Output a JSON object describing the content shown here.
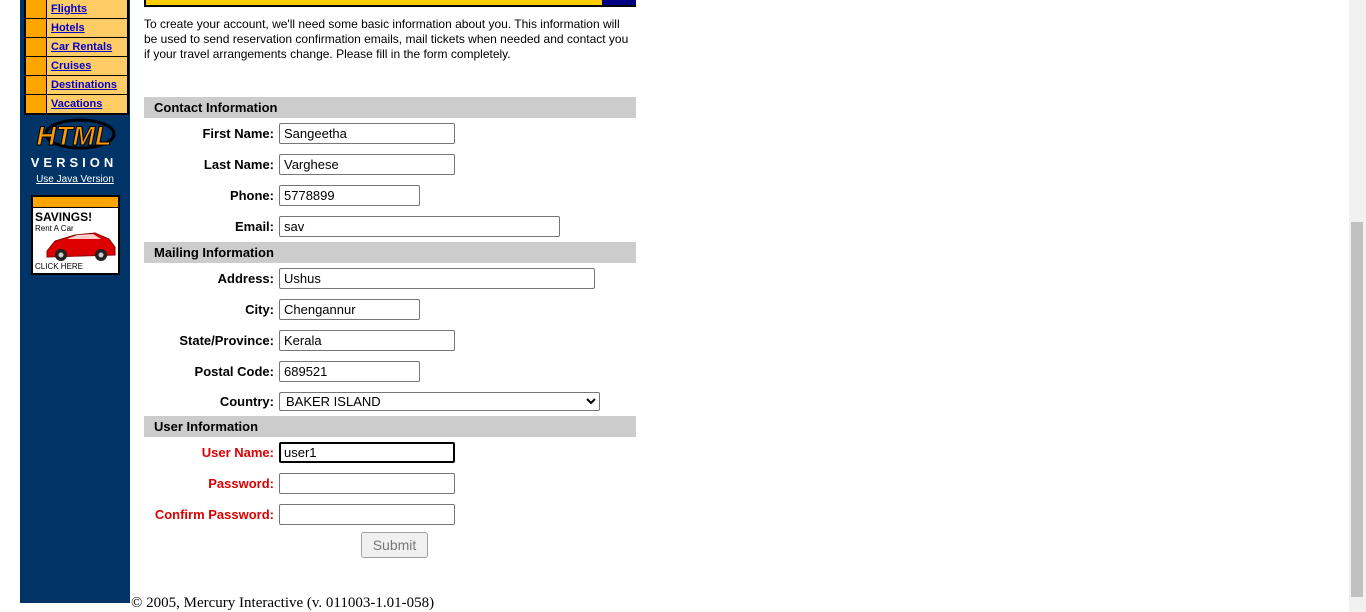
{
  "nav": {
    "items": [
      {
        "label": "Flights"
      },
      {
        "label": "Hotels"
      },
      {
        "label": "Car Rentals"
      },
      {
        "label": "Cruises"
      },
      {
        "label": "Destinations"
      },
      {
        "label": "Vacations"
      }
    ],
    "logo_text_1": "HTML",
    "logo_text_2": "VERSION",
    "java_link": "Use Java Version",
    "ad": {
      "savings": "SAVINGS!",
      "rent": "Rent A Car",
      "click": "CLICK HERE"
    }
  },
  "intro": "To create your account, we'll need some basic information about you. This information will be used to send reservation confirmation emails, mail tickets when needed and contact you if your travel arrangements change. Please fill in the form completely.",
  "contact": {
    "heading": "Contact Information",
    "first_name_label": "First Name:",
    "first_name": "Sangeetha",
    "last_name_label": "Last Name:",
    "last_name": "Varghese",
    "phone_label": "Phone:",
    "phone": "5778899",
    "email_label": "Email:",
    "email": "sav"
  },
  "mailing": {
    "heading": "Mailing Information",
    "address_label": "Address:",
    "address": "Ushus",
    "city_label": "City:",
    "city": "Chengannur",
    "state_label": "State/Province:",
    "state": "Kerala",
    "postal_label": "Postal Code:",
    "postal": "689521",
    "country_label": "Country:",
    "country": "BAKER ISLAND"
  },
  "user": {
    "heading": "User Information",
    "username_label": "User Name:",
    "username": "user1",
    "password_label": "Password:",
    "password": "",
    "confirm_label": "Confirm Password:",
    "confirm": ""
  },
  "submit_label": "Submit",
  "copyright": "© 2005, Mercury Interactive (v. 011003-1.01-058)",
  "colors": {
    "sidebar": "#003366",
    "nav_orange": "#ffa500",
    "nav_cell": "#ffcc66",
    "section_gray": "#cccccc",
    "required_red": "#dd0000"
  }
}
